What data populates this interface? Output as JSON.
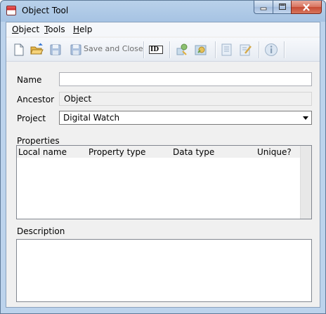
{
  "window": {
    "title": "Object Tool"
  },
  "menu": [
    {
      "label": "Object",
      "accel": "O",
      "rest": "bject"
    },
    {
      "label": "Tools",
      "accel": "T",
      "rest": "ools"
    },
    {
      "label": "Help",
      "accel": "H",
      "rest": "elp"
    }
  ],
  "toolbar": {
    "save_close_label": "Save and Close",
    "id_label": "ID"
  },
  "form": {
    "name_label": "Name",
    "name_value": "",
    "ancestor_label": "Ancestor",
    "ancestor_value": "Object",
    "project_label": "Project",
    "project_value": "Digital Watch",
    "properties_label": "Properties",
    "columns": [
      "Local name",
      "Property type",
      "Data type",
      "Unique?"
    ],
    "description_label": "Description"
  },
  "colors": {
    "title_bar": "#b9d1ea",
    "close_button": "#c64a33",
    "client_bg": "#f0f0f0"
  }
}
